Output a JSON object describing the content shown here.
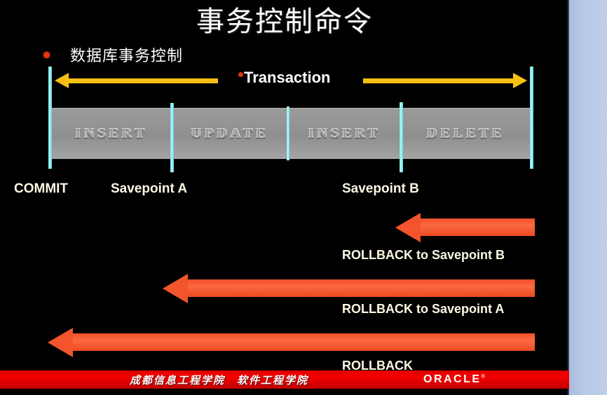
{
  "slide": {
    "title": "事务控制命令",
    "background_color": "#000000",
    "right_panel_color": "#b6c8e4"
  },
  "bullet": {
    "marker": "bullet-dot",
    "text": "数据库事务控制",
    "marker_color": "#e8330c"
  },
  "transaction_axis": {
    "label": "Transaction",
    "marker": "bullet-dot",
    "arrow_color": "#f7c011",
    "direction": "double"
  },
  "statements": [
    {
      "name": "INSERT",
      "label": "INSERT"
    },
    {
      "name": "UPDATE",
      "label": "UPDATE"
    },
    {
      "name": "INSERT",
      "label": "INSERT"
    },
    {
      "name": "DELETE",
      "label": "DELETE"
    }
  ],
  "timeline_labels": [
    {
      "label": "COMMIT"
    },
    {
      "label": "Savepoint A"
    },
    {
      "label": "Savepoint B"
    }
  ],
  "rollback_arrows": [
    {
      "caption": "ROLLBACK to Savepoint  B",
      "color": "#f4542c"
    },
    {
      "caption": "ROLLBACK to Savepoint A",
      "color": "#f4542c"
    },
    {
      "caption": "ROLLBACK",
      "color": "#f4542c"
    }
  ],
  "footer": {
    "school": "成都信息工程学院　软件工程学院",
    "brand": "ORACLE",
    "brand_mark": "®",
    "bar_color": "#e00000"
  }
}
